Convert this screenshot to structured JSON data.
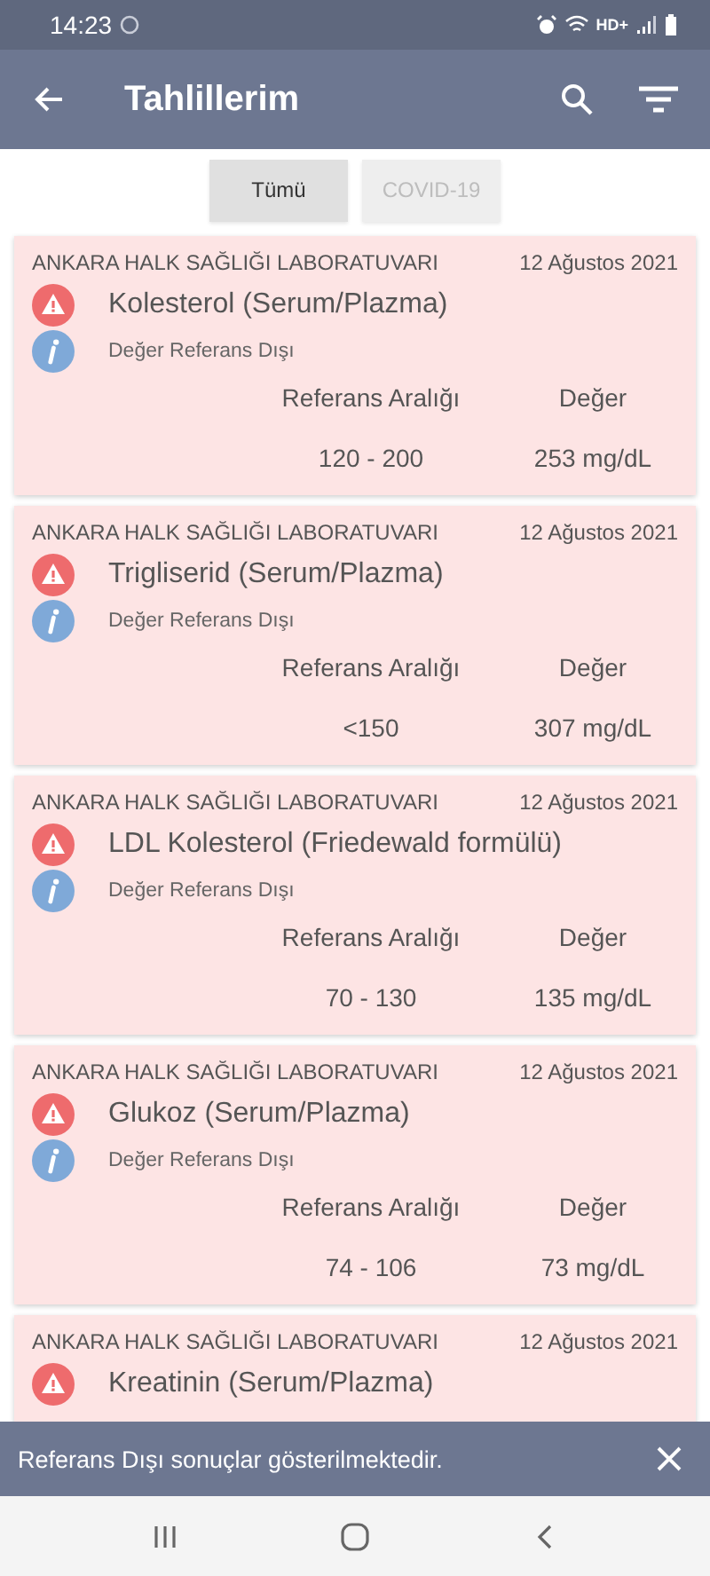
{
  "status_bar": {
    "time": "14:23",
    "network": "HD+"
  },
  "app_bar": {
    "title": "Tahlillerim"
  },
  "tabs": [
    {
      "label": "Tümü",
      "selected": true
    },
    {
      "label": "COVID-19",
      "selected": false
    }
  ],
  "results": [
    {
      "lab": "ANKARA HALK SAĞLIĞI LABORATUVARI",
      "date": "12 Ağustos 2021",
      "test": "Kolesterol (Serum/Plazma)",
      "status": "Değer Referans Dışı",
      "range_label": "Referans Aralığı",
      "value_label": "Değer",
      "range": "120 - 200",
      "value": "253 mg/dL"
    },
    {
      "lab": "ANKARA HALK SAĞLIĞI LABORATUVARI",
      "date": "12 Ağustos 2021",
      "test": "Trigliserid (Serum/Plazma)",
      "status": "Değer Referans Dışı",
      "range_label": "Referans Aralığı",
      "value_label": "Değer",
      "range": "<150",
      "value": "307 mg/dL"
    },
    {
      "lab": "ANKARA HALK SAĞLIĞI LABORATUVARI",
      "date": "12 Ağustos 2021",
      "test": "LDL Kolesterol (Friedewald formülü)",
      "status": "Değer Referans Dışı",
      "range_label": "Referans Aralığı",
      "value_label": "Değer",
      "range": "70 - 130",
      "value": "135 mg/dL"
    },
    {
      "lab": "ANKARA HALK SAĞLIĞI LABORATUVARI",
      "date": "12 Ağustos 2021",
      "test": "Glukoz (Serum/Plazma)",
      "status": "Değer Referans Dışı",
      "range_label": "Referans Aralığı",
      "value_label": "Değer",
      "range": "74 - 106",
      "value": "73 mg/dL"
    },
    {
      "lab": "ANKARA HALK SAĞLIĞI LABORATUVARI",
      "date": "12 Ağustos 2021",
      "test": "Kreatinin (Serum/Plazma)"
    }
  ],
  "snackbar": {
    "message": "Referans Dışı sonuçlar gösterilmektedir."
  }
}
